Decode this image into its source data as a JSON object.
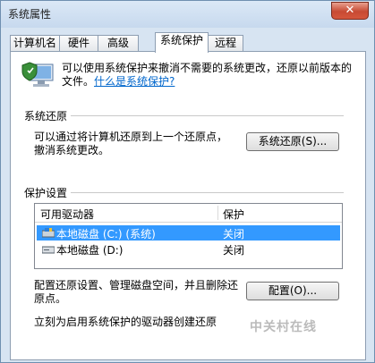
{
  "window": {
    "title": "系统属性",
    "close_label": "✕"
  },
  "tabs": [
    {
      "label": "计算机名",
      "active": false
    },
    {
      "label": "硬件",
      "active": false
    },
    {
      "label": "高级",
      "active": false
    },
    {
      "label": "系统保护",
      "active": true
    },
    {
      "label": "远程",
      "active": false
    }
  ],
  "intro": {
    "text": "可以使用系统保护来撤消不需要的系统更改，还原以前版本的文件。",
    "link": "什么是系统保护?"
  },
  "restore": {
    "title": "系统还原",
    "desc": "可以通过将计算机还原到上一个还原点，撤消系统更改。",
    "button": "系统还原(S)..."
  },
  "protection": {
    "title": "保护设置",
    "headers": [
      "可用驱动器",
      "保护"
    ],
    "rows": [
      {
        "drive": "本地磁盘 (C:) (系统)",
        "status": "关闭",
        "selected": true
      },
      {
        "drive": "本地磁盘 (D:)",
        "status": "关闭",
        "selected": false
      }
    ],
    "config_desc": "配置还原设置、管理磁盘空间，并且删除还原点。",
    "config_button": "配置(O)...",
    "create_desc": "立刻为启用系统保护的驱动器创建还原"
  },
  "watermark": "中关村在线",
  "colors": {
    "selection": "#3399ff",
    "link": "#0066cc"
  }
}
